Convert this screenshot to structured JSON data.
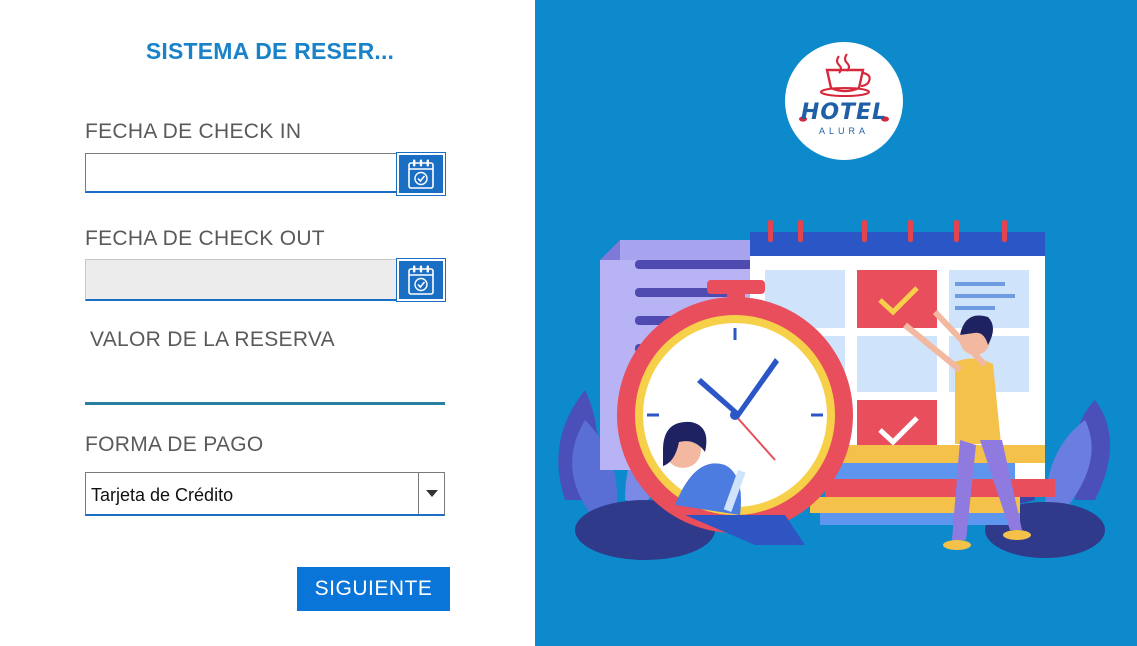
{
  "form": {
    "title": "SISTEMA DE RESER...",
    "checkin_label": "FECHA DE CHECK IN",
    "checkin_value": "",
    "checkout_label": "FECHA DE CHECK OUT",
    "checkout_value": "",
    "valor_label": "VALOR DE LA RESERVA",
    "valor_value": "",
    "pago_label": "FORMA DE PAGO",
    "pago_selected": "Tarjeta de Crédito",
    "next_label": "SIGUIENTE"
  },
  "brand": {
    "logo_main": "HOTEL",
    "logo_sub": "ALURA"
  },
  "colors": {
    "accent": "#0a75d8",
    "title": "#1a82c8",
    "panel_bg": "#0d8acb"
  },
  "icons": {
    "calendar": "calendar-icon",
    "dropdown": "chevron-down-icon"
  }
}
